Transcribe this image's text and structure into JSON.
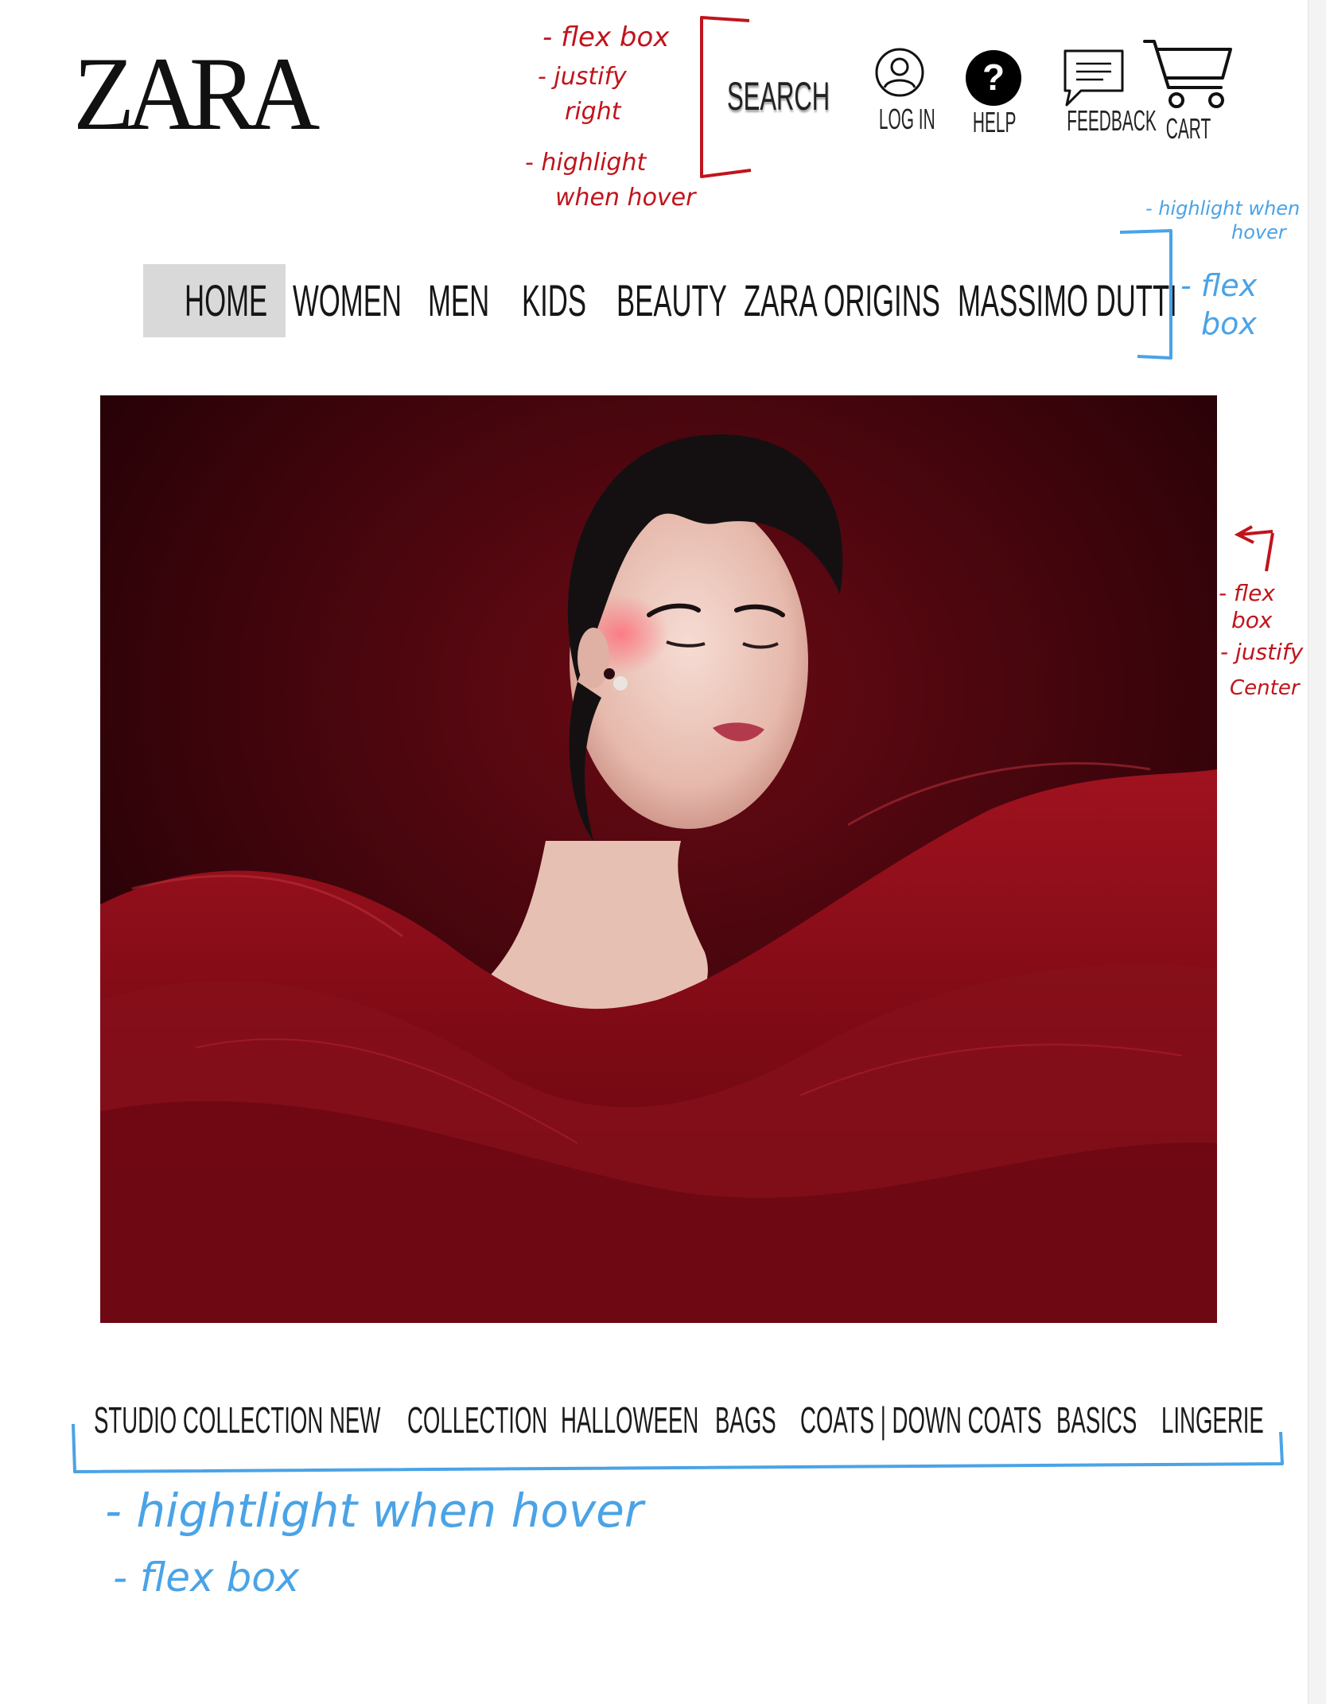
{
  "header": {
    "logo": "ZARA",
    "search_label": "SEARCH",
    "actions": [
      {
        "label": "LOG IN",
        "icon": "user-icon"
      },
      {
        "label": "HELP",
        "icon": "help-icon"
      },
      {
        "label": "FEEDBACK",
        "icon": "feedback-icon"
      },
      {
        "label": "CART",
        "icon": "cart-icon"
      }
    ]
  },
  "top_nav": {
    "items": [
      "HOME",
      "WOMEN",
      "MEN",
      "KIDS",
      "BEAUTY",
      "ZARA ORIGINS",
      "MASSIMO DUTTI"
    ],
    "active": "HOME"
  },
  "hero": {
    "image": "fashion-portrait-red-tulle"
  },
  "bottom_nav": {
    "items": [
      "STUDIO COLLECTION",
      "NEW",
      "COLLECTION",
      "HALLOWEEN",
      "BAGS",
      "COATS | DOWN COATS",
      "BASICS",
      "LINGERIE"
    ]
  },
  "annotations": {
    "header_red": [
      "- flex box",
      "- justify",
      "right",
      "- highlight",
      "when hover"
    ],
    "nav_blue_top": [
      "- highlight when",
      "hover"
    ],
    "nav_blue_side": [
      "- flex",
      "box"
    ],
    "hero_red": [
      "- flex",
      "box",
      "- justify",
      "Center"
    ],
    "bottom_blue": [
      "- hightlight  when hover",
      "- flex box"
    ]
  },
  "colors": {
    "annotation_red": "#c0141c",
    "annotation_blue": "#4aa3e6",
    "home_highlight": "#d9d9d9",
    "hero_red": "#7a0a12"
  }
}
